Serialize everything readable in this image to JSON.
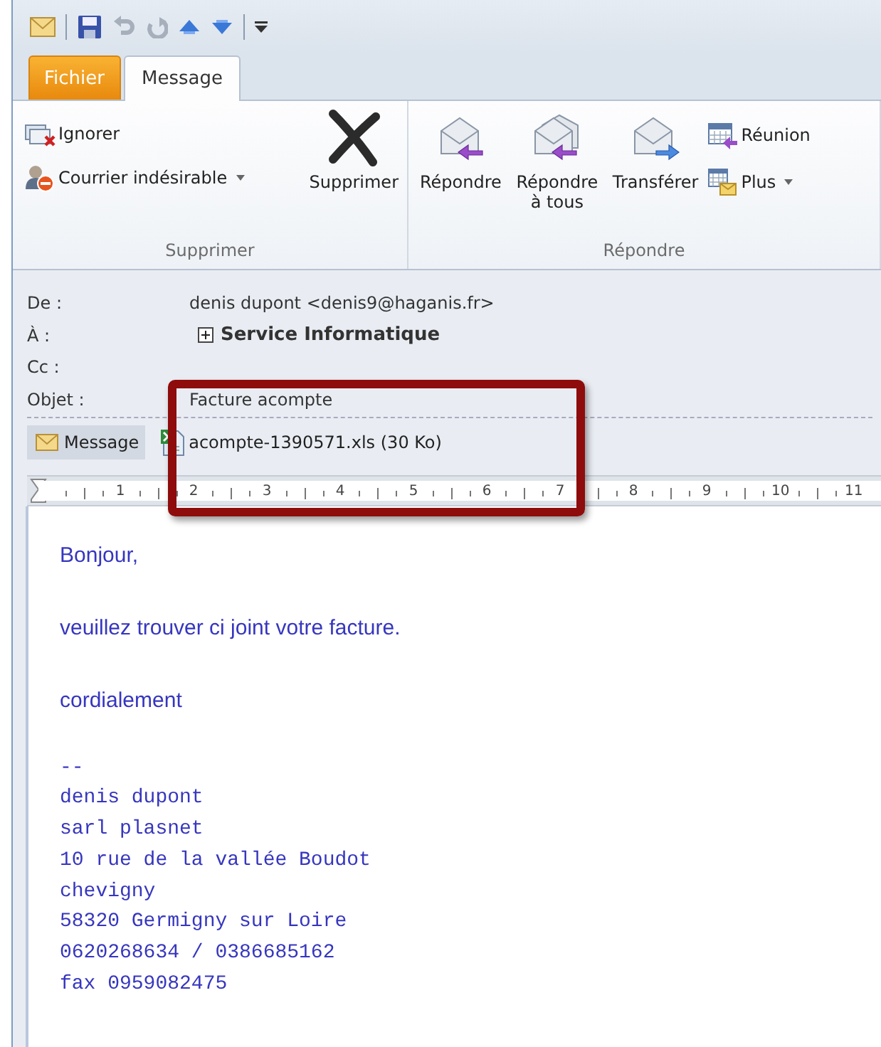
{
  "tabs": [
    {
      "label": "Fichier",
      "kind": "file",
      "selected": false
    },
    {
      "label": "Message",
      "kind": "tab",
      "selected": true
    }
  ],
  "ribbon": {
    "groups": [
      {
        "label": "Supprimer",
        "items": [
          {
            "label": "Ignorer",
            "kind": "small",
            "dropdown": false
          },
          {
            "label": "Courrier indésirable",
            "kind": "small",
            "dropdown": true
          },
          {
            "label": "Supprimer",
            "kind": "large",
            "dropdown": false
          }
        ]
      },
      {
        "label": "Répondre",
        "items": [
          {
            "label": "Répondre",
            "kind": "large",
            "dropdown": false
          },
          {
            "label": "Répondre à tous",
            "kind": "large",
            "dropdown": false
          },
          {
            "label": "Transférer",
            "kind": "large",
            "dropdown": false
          },
          {
            "label": "Réunion",
            "kind": "small",
            "dropdown": false
          },
          {
            "label": "Plus",
            "kind": "small",
            "dropdown": true
          }
        ]
      }
    ]
  },
  "header": {
    "fields": [
      {
        "label": "De :",
        "value": "denis dupont <denis9@haganis.fr>",
        "kind": "text"
      },
      {
        "label": "À :",
        "value": "Service Informatique",
        "kind": "contact"
      },
      {
        "label": "Cc :"
      },
      {
        "label": "Objet :",
        "value": "Facture acompte",
        "kind": "text"
      }
    ]
  },
  "attachments": {
    "message_tab": {
      "label": "Message",
      "selected": true
    },
    "files": [
      {
        "name": "acompte-1390571.xls (30 Ko)"
      }
    ]
  },
  "ruler": {
    "labels": [
      "1",
      "2",
      "3",
      "4",
      "5",
      "6",
      "7",
      "8",
      "9",
      "10",
      "11"
    ]
  },
  "body": {
    "lines": [
      {
        "text": "Bonjour,",
        "kind": "prose"
      },
      {
        "text": "veuillez trouver ci joint votre facture.",
        "kind": "prose"
      },
      {
        "text": "cordialement",
        "kind": "prose"
      },
      {
        "text": "--",
        "kind": "mono"
      },
      {
        "text": "denis dupont",
        "kind": "mono"
      },
      {
        "text": "sarl plasnet",
        "kind": "mono"
      },
      {
        "text": "10 rue de la vallée Boudot",
        "kind": "mono"
      },
      {
        "text": "chevigny",
        "kind": "mono"
      },
      {
        "text": "58320 Germigny sur Loire",
        "kind": "mono"
      },
      {
        "text": "0620268634 / 0386685162",
        "kind": "mono"
      },
      {
        "text": "fax 0959082475",
        "kind": "mono"
      }
    ]
  }
}
